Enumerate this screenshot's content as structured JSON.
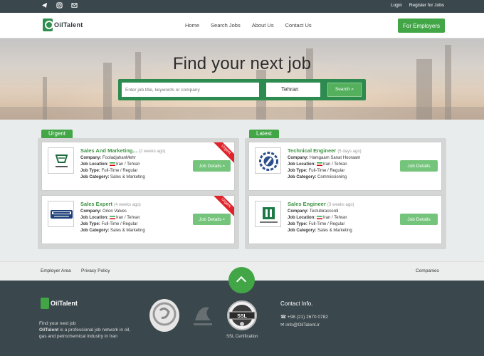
{
  "topbar": {
    "social_icons": [
      "telegram-icon",
      "instagram-icon",
      "email-icon"
    ],
    "login": "Login",
    "register": "Register for Jobs"
  },
  "header": {
    "logo_text": "OilTalent",
    "nav": [
      "Home",
      "Search Jobs",
      "About Us",
      "Contact Us"
    ],
    "employers_button": "For Employers"
  },
  "hero": {
    "title": "Find your next job",
    "search_placeholder": "Enter job title, keywords or company",
    "location": "Tehran",
    "search_button": "Search"
  },
  "labels": {
    "company": "Company:",
    "location": "Job Location:",
    "type": "Job Type:",
    "category": "Job Category:",
    "details": "Job Details",
    "ribbon": "Urgent"
  },
  "urgent": {
    "label": "Urgent",
    "jobs": [
      {
        "title": "Sales And Marketing...",
        "ago": "(2 weeks ago)",
        "company": "FooladjahanMehr",
        "location": "Iran / Tehran",
        "type": "Full-Time / Regular",
        "category": "Sales & Marketing"
      },
      {
        "title": "Sales Expert",
        "ago": "(4 weeks ago)",
        "company": "Orion Valves",
        "location": "Iran / Tehran",
        "type": "Full-Time / Regular",
        "category": "Sales & Marketing"
      }
    ]
  },
  "latest": {
    "label": "Latest",
    "jobs": [
      {
        "title": "Technical Engineer",
        "ago": "(5 days ago)",
        "company": "Hamgaam Sanat Hooraam",
        "location": "Iran / Tehran",
        "type": "Full-Time / Regular",
        "category": "Commissioning"
      },
      {
        "title": "Sales Engineer",
        "ago": "(3 weeks ago)",
        "company": "Tectubiraccordi",
        "location": "Iran / Tehran",
        "type": "Full-Time / Regular",
        "category": "Sales & Marketing"
      }
    ]
  },
  "footer_links": {
    "employer_area": "Employer Area",
    "privacy": "Privacy Policy",
    "companies": "Companies"
  },
  "footer": {
    "logo_text": "OilTalent",
    "intro_line1": "Find your next job",
    "brand": "OilTalent",
    "intro_rest": " is a professional job network in oil, gas and petrochemical industry in Iran",
    "ssl_caption": "SSL Certification",
    "contact_title": "Contact Info.",
    "phone": "+98 (21) 2670 0782",
    "email": "info@OilTalent.ir"
  },
  "colors": {
    "brand_green": "#42a647",
    "dark": "#3a474d",
    "ribbon_red": "#e0232b"
  }
}
